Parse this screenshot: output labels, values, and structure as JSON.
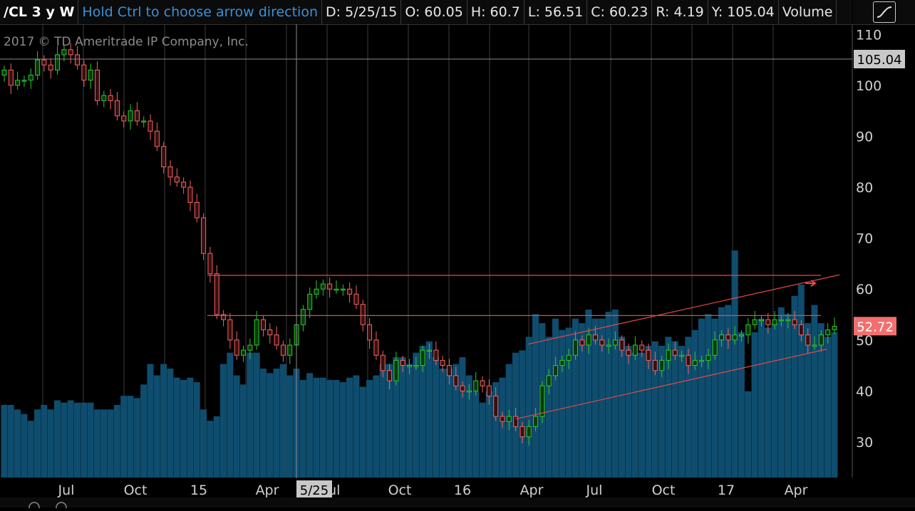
{
  "header": {
    "symbol": "/CL 3 y W",
    "hint": "Hold Ctrl to choose arrow direction",
    "date": "D: 5/25/15",
    "open": "O: 60.05",
    "high": "H: 60.7",
    "low": "L: 56.51",
    "close": "C: 60.23",
    "range": "R: 4.19",
    "y": "Y: 105.04",
    "volume": "Volume"
  },
  "chart": {
    "copyright": "2017 © TD Ameritrade IP Company, Inc.",
    "crosshair_price": "105.04",
    "crosshair_date": "5/25",
    "last_price": "52.72",
    "colors": {
      "background": "#000000",
      "up_candle": "#2fc72f",
      "down_candle": "#f06464",
      "volume": "#0f4d6e",
      "grid": "#3c3c3c",
      "trendline": "#e84848",
      "last_price_badge": "#f26f6f"
    }
  },
  "chart_data": {
    "type": "candlestick",
    "ylim": [
      23,
      112
    ],
    "y_ticks": [
      30,
      40,
      50,
      60,
      70,
      80,
      90,
      100,
      110
    ],
    "x_labels": [
      "Jul",
      "Oct",
      "15",
      "Apr",
      "Jul",
      "Oct",
      "16",
      "Apr",
      "Jul",
      "Oct",
      "17",
      "Apr"
    ],
    "closes": [
      103,
      100,
      101,
      101,
      102,
      105,
      104,
      103,
      106,
      107,
      106,
      104,
      101,
      103,
      97,
      98,
      97,
      94,
      93,
      95,
      93,
      93,
      91,
      88,
      84,
      82,
      81,
      80,
      77,
      74,
      67,
      63,
      55,
      54,
      50,
      47,
      48,
      49,
      54,
      52,
      51,
      49,
      47,
      49,
      53,
      56,
      59,
      60,
      61,
      60,
      60,
      60,
      59,
      57,
      53,
      50,
      47,
      44,
      42,
      46,
      45,
      45,
      45,
      48,
      48,
      46,
      45,
      43,
      41,
      40,
      40,
      42,
      41,
      39,
      35,
      34,
      35,
      33,
      31,
      33,
      35,
      41,
      43,
      45,
      46,
      47,
      50,
      49,
      51,
      50,
      49,
      49,
      50,
      48,
      47,
      49,
      48,
      46,
      44,
      46,
      48,
      47,
      47,
      45,
      46,
      46,
      47,
      50,
      51,
      50,
      51,
      51,
      53,
      54,
      54,
      53,
      54,
      54,
      54,
      53,
      51,
      49,
      49,
      51,
      52,
      52.7
    ],
    "volume_levels": [
      0.32,
      0.32,
      0.3,
      0.28,
      0.25,
      0.3,
      0.32,
      0.3,
      0.34,
      0.33,
      0.34,
      0.33,
      0.33,
      0.33,
      0.3,
      0.3,
      0.3,
      0.32,
      0.36,
      0.36,
      0.35,
      0.41,
      0.5,
      0.45,
      0.5,
      0.48,
      0.44,
      0.43,
      0.44,
      0.42,
      0.3,
      0.25,
      0.27,
      0.5,
      0.55,
      0.45,
      0.41,
      0.55,
      0.55,
      0.48,
      0.46,
      0.48,
      0.5,
      0.45,
      0.48,
      0.43,
      0.46,
      0.44,
      0.44,
      0.43,
      0.43,
      0.42,
      0.44,
      0.45,
      0.4,
      0.43,
      0.45,
      0.5,
      0.5,
      0.53,
      0.53,
      0.5,
      0.55,
      0.58,
      0.6,
      0.53,
      0.48,
      0.48,
      0.5,
      0.53,
      0.45,
      0.38,
      0.33,
      0.38,
      0.42,
      0.44,
      0.5,
      0.55,
      0.56,
      0.62,
      0.72,
      0.68,
      0.62,
      0.7,
      0.65,
      0.66,
      0.7,
      0.68,
      0.74,
      0.7,
      0.7,
      0.73,
      0.74,
      0.62,
      0.58,
      0.55,
      0.55,
      0.58,
      0.6,
      0.58,
      0.62,
      0.6,
      0.58,
      0.62,
      0.65,
      0.7,
      0.72,
      0.7,
      0.75,
      0.76,
      1.0,
      0.64,
      0.38,
      0.64,
      0.7,
      0.66,
      0.68,
      0.75,
      0.72,
      0.8,
      0.85,
      0.68,
      0.76,
      0.68,
      0.62,
      0.64
    ],
    "annotations": {
      "horizontal_lines": [
        62.7,
        54.8
      ],
      "channel_upper": [
        [
          0.62,
          49.2
        ],
        [
          0.985,
          62.8
        ]
      ],
      "channel_lower": [
        [
          0.605,
          34.5
        ],
        [
          0.97,
          48.2
        ]
      ]
    }
  }
}
